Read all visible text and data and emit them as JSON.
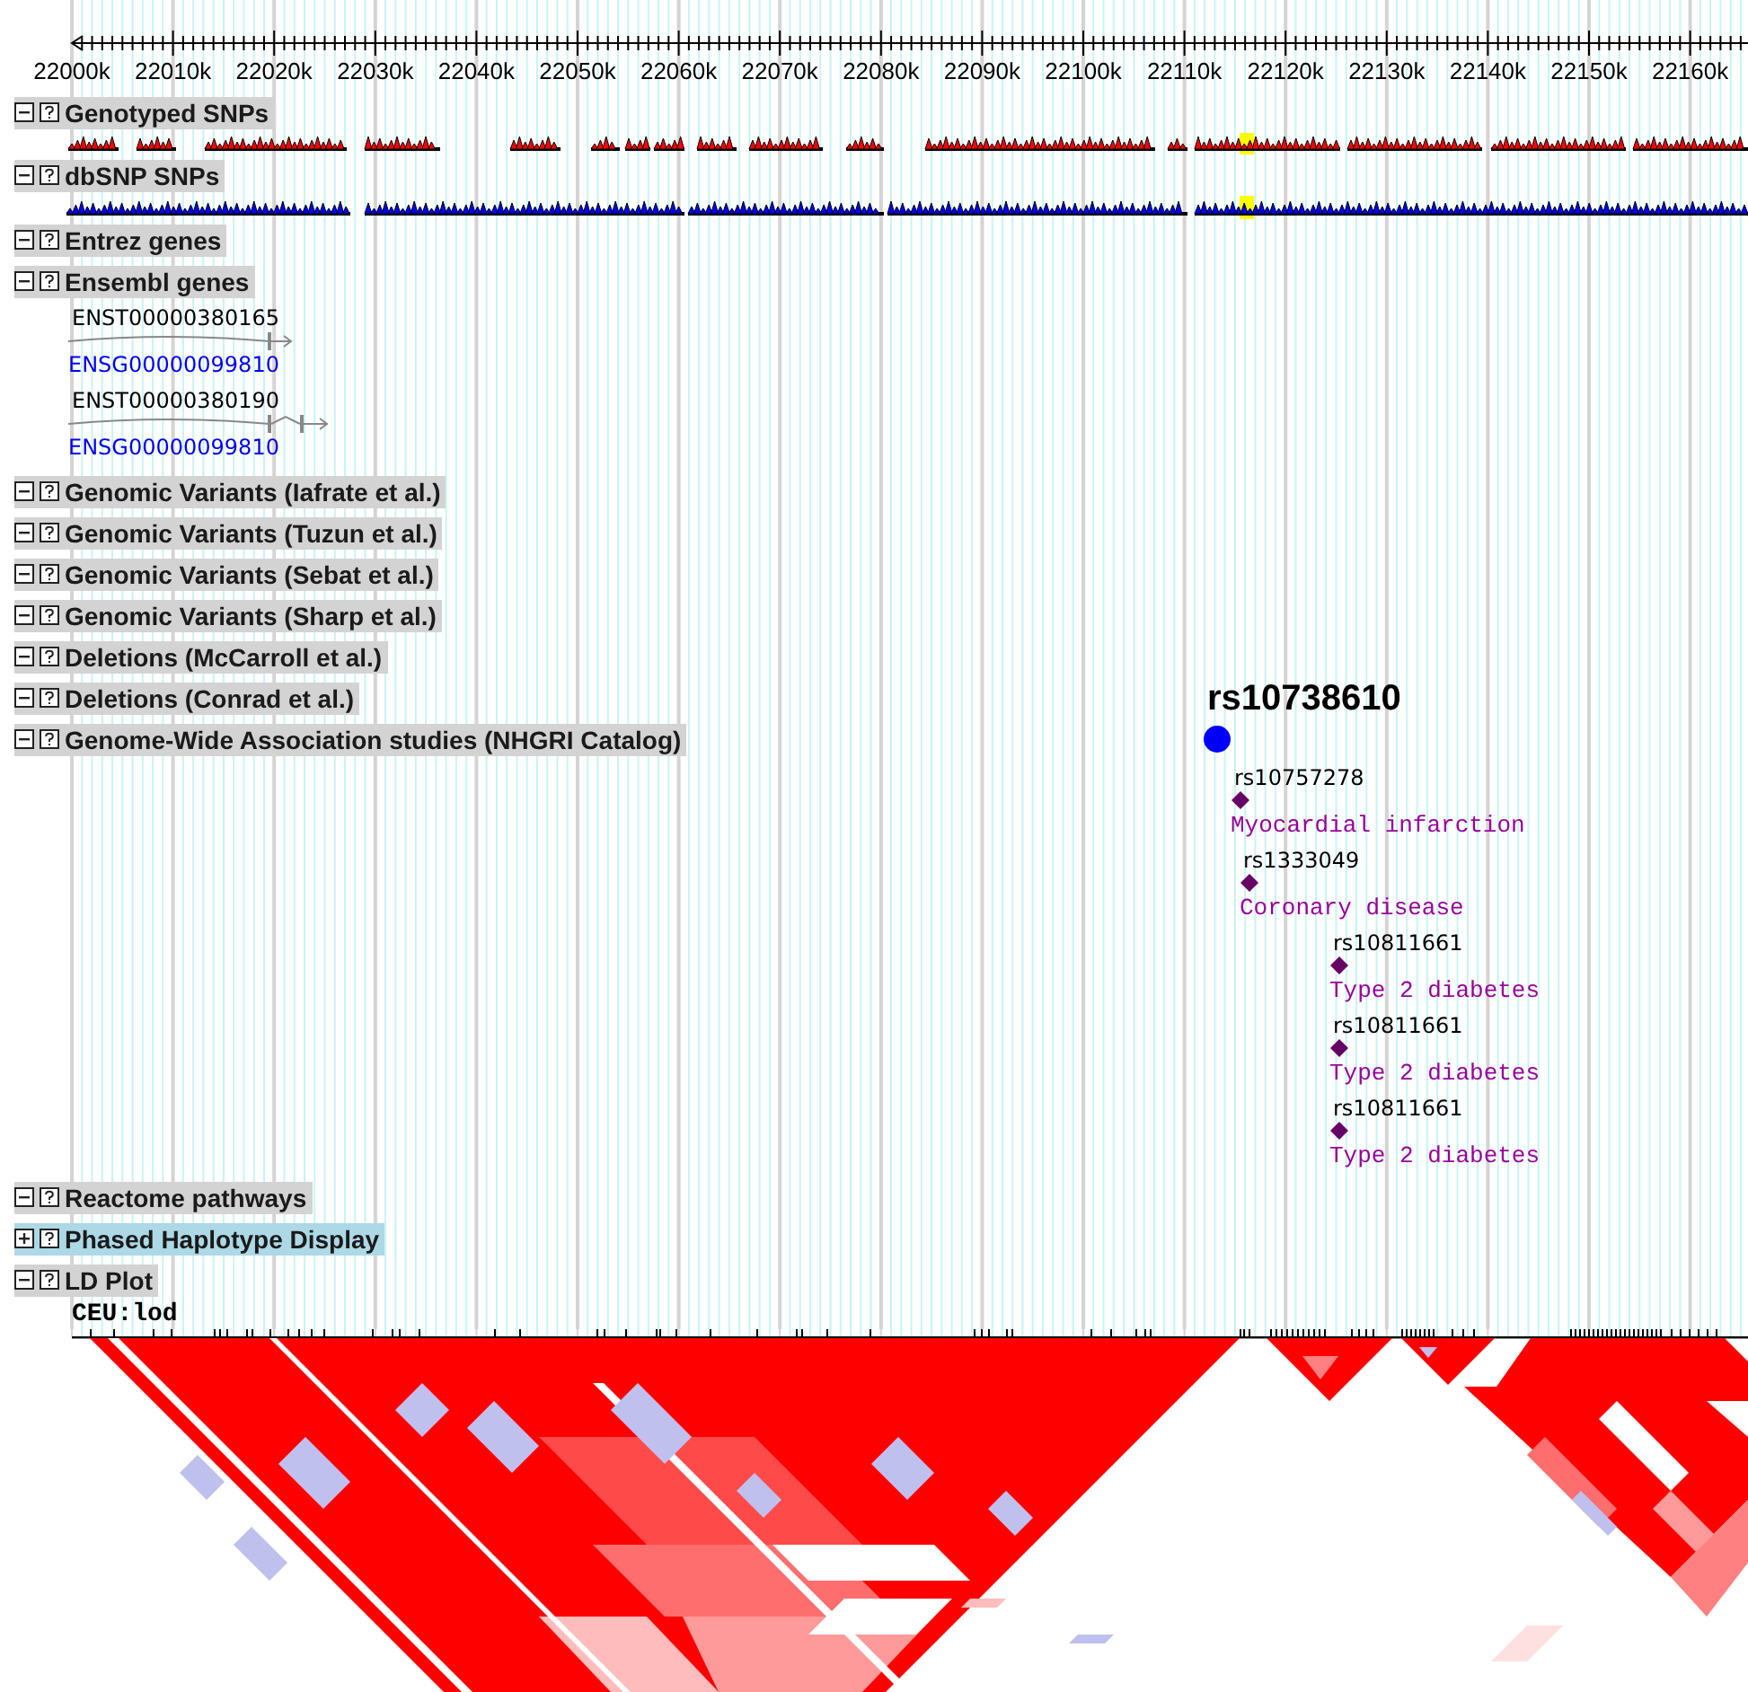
{
  "ruler": {
    "labels": [
      "22000k",
      "22010k",
      "22020k",
      "22030k",
      "22040k",
      "22050k",
      "22060k",
      "22070k",
      "22080k",
      "22090k",
      "22100k",
      "22110k",
      "22120k",
      "22130k",
      "22140k",
      "22150k",
      "22160k"
    ]
  },
  "tracks": [
    {
      "kind": "snps",
      "title": "Genotyped SNPs",
      "expanded": true,
      "selected": false,
      "color": "#ff0000"
    },
    {
      "kind": "snps",
      "title": "dbSNP SNPs",
      "expanded": true,
      "selected": false,
      "color": "#0000ff"
    },
    {
      "kind": "plain",
      "title": "Entrez genes",
      "expanded": true,
      "selected": false
    },
    {
      "kind": "genes",
      "title": "Ensembl genes",
      "expanded": true,
      "selected": false,
      "genes": [
        {
          "transcript": "ENST00000380165",
          "gene": "ENSG00000099810"
        },
        {
          "transcript": "ENST00000380190",
          "gene": "ENSG00000099810"
        }
      ]
    },
    {
      "kind": "plain",
      "title": "Genomic Variants (Iafrate et al.)",
      "expanded": true,
      "selected": false
    },
    {
      "kind": "plain",
      "title": "Genomic Variants (Tuzun et al.)",
      "expanded": true,
      "selected": false
    },
    {
      "kind": "plain",
      "title": "Genomic Variants (Sebat et al.)",
      "expanded": true,
      "selected": false
    },
    {
      "kind": "plain",
      "title": "Genomic Variants (Sharp et al.)",
      "expanded": true,
      "selected": false
    },
    {
      "kind": "plain",
      "title": "Deletions (McCarroll et al.)",
      "expanded": true,
      "selected": false
    },
    {
      "kind": "plain",
      "title": "Deletions (Conrad et al.)",
      "expanded": true,
      "selected": false
    },
    {
      "kind": "gwas",
      "title": "Genome-Wide Association studies (NHGRI Catalog)",
      "expanded": true,
      "selected": false,
      "lead_snp": "rs10738610",
      "hits": [
        {
          "snp": "rs10757278",
          "trait": "Myocardial infarction"
        },
        {
          "snp": "rs1333049",
          "trait": "Coronary disease"
        },
        {
          "snp": "rs10811661",
          "trait": "Type 2 diabetes"
        },
        {
          "snp": "rs10811661",
          "trait": "Type 2 diabetes"
        },
        {
          "snp": "rs10811661",
          "trait": "Type 2 diabetes"
        }
      ]
    },
    {
      "kind": "plain",
      "title": "Reactome pathways",
      "expanded": true,
      "selected": false
    },
    {
      "kind": "plain",
      "title": "Phased Haplotype Display",
      "expanded": false,
      "selected": true
    },
    {
      "kind": "ld",
      "title": "LD Plot",
      "expanded": true,
      "selected": false,
      "population_label": "CEU:lod"
    }
  ]
}
